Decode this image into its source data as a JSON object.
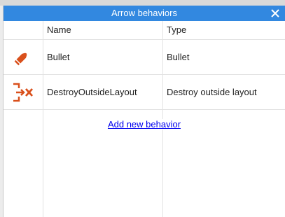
{
  "dialog": {
    "title": "Arrow behaviors"
  },
  "table": {
    "columns": [
      "Name",
      "Type"
    ],
    "rows": [
      {
        "icon": "bullet-icon",
        "name": "Bullet",
        "type": "Bullet"
      },
      {
        "icon": "destroy-outside-layout-icon",
        "name": "DestroyOutsideLayout",
        "type": "Destroy outside layout"
      }
    ]
  },
  "actions": {
    "add_label": "Add new behavior"
  },
  "colors": {
    "titlebar": "#3288e0",
    "icon_accent": "#d9501c",
    "link": "#0000ee"
  }
}
